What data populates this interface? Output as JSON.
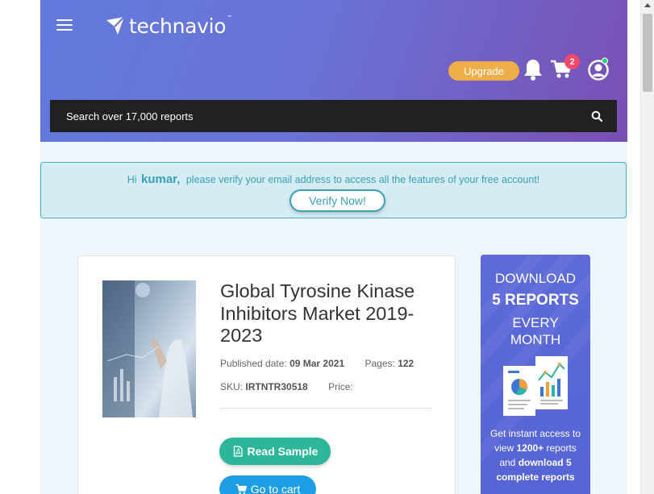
{
  "header": {
    "logo_text": "technavio",
    "logo_tm": "™",
    "upgrade_label": "Upgrade",
    "cart_count": "2",
    "search_placeholder": "Search over 17,000 reports"
  },
  "verify": {
    "greeting": "Hi",
    "user_name": "kumar,",
    "message": "please verify your email address to access all the features of your free account!",
    "button_label": "Verify Now!"
  },
  "report": {
    "title": "Global Tyrosine Kinase Inhibitors Market 2019-2023",
    "published_label": "Published date:",
    "published_value": "09 Mar 2021",
    "pages_label": "Pages:",
    "pages_value": "122",
    "sku_label": "SKU:",
    "sku_value": "IRTNTR30518",
    "price_label": "Price:",
    "read_sample_label": "Read Sample",
    "go_to_cart_label": "Go to cart"
  },
  "promo": {
    "line1": "DOWNLOAD",
    "line2": "5 REPORTS",
    "line3": "EVERY",
    "line4": "MONTH",
    "body_1": "Get instant access to view",
    "body_2": "1200+",
    "body_3": "reports and",
    "body_4": "download 5 complete reports"
  },
  "colors": {
    "accent_green": "#2cb79a",
    "accent_blue": "#1e9ee6",
    "upgrade_orange": "#efad4a",
    "badge_red": "#f0476a",
    "verify_teal": "#3a9fb7"
  },
  "icons": [
    "menu-icon",
    "logo-icon",
    "bell-icon",
    "cart-icon",
    "user-icon",
    "search-icon",
    "pdf-icon",
    "cart-button-icon"
  ]
}
